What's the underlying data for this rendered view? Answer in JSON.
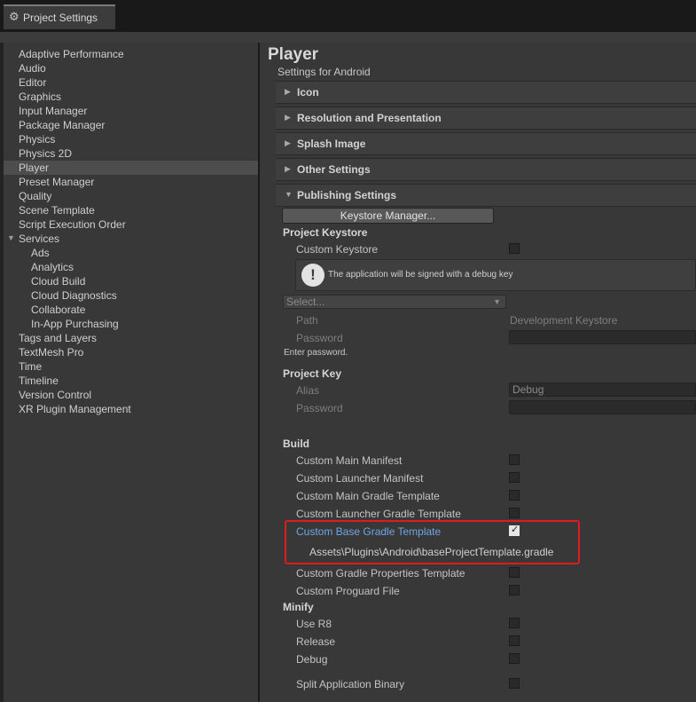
{
  "window": {
    "tab_title": "Project Settings",
    "tab_icon": "gear-icon"
  },
  "sidebar": {
    "items": [
      {
        "label": "Adaptive Performance",
        "indent": 0
      },
      {
        "label": "Audio",
        "indent": 0
      },
      {
        "label": "Editor",
        "indent": 0
      },
      {
        "label": "Graphics",
        "indent": 0
      },
      {
        "label": "Input Manager",
        "indent": 0
      },
      {
        "label": "Package Manager",
        "indent": 0
      },
      {
        "label": "Physics",
        "indent": 0
      },
      {
        "label": "Physics 2D",
        "indent": 0
      },
      {
        "label": "Player",
        "indent": 0,
        "selected": true
      },
      {
        "label": "Preset Manager",
        "indent": 0
      },
      {
        "label": "Quality",
        "indent": 0
      },
      {
        "label": "Scene Template",
        "indent": 0
      },
      {
        "label": "Script Execution Order",
        "indent": 0
      },
      {
        "label": "Services",
        "indent": 0,
        "expanded": true
      },
      {
        "label": "Ads",
        "indent": 1
      },
      {
        "label": "Analytics",
        "indent": 1
      },
      {
        "label": "Cloud Build",
        "indent": 1
      },
      {
        "label": "Cloud Diagnostics",
        "indent": 1
      },
      {
        "label": "Collaborate",
        "indent": 1
      },
      {
        "label": "In-App Purchasing",
        "indent": 1
      },
      {
        "label": "Tags and Layers",
        "indent": 0
      },
      {
        "label": "TextMesh Pro",
        "indent": 0
      },
      {
        "label": "Time",
        "indent": 0
      },
      {
        "label": "Timeline",
        "indent": 0
      },
      {
        "label": "Version Control",
        "indent": 0
      },
      {
        "label": "XR Plugin Management",
        "indent": 0
      }
    ]
  },
  "main": {
    "title": "Player",
    "subtitle": "Settings for Android",
    "sections": {
      "icon": "Icon",
      "resolution": "Resolution and Presentation",
      "splash": "Splash Image",
      "other": "Other Settings",
      "publishing": "Publishing Settings"
    },
    "keystore_manager_button": "Keystore Manager...",
    "project_keystore": {
      "header": "Project Keystore",
      "custom_keystore_label": "Custom Keystore",
      "custom_keystore_checked": false,
      "help_text": "The application will be signed with a debug key",
      "select_placeholder": "Select...",
      "path_label": "Path",
      "path_value": "Development Keystore",
      "password_label": "Password",
      "password_value": "",
      "password_hint": "Enter password."
    },
    "project_key": {
      "header": "Project Key",
      "alias_label": "Alias",
      "alias_value": "Debug",
      "password_label": "Password",
      "password_value": ""
    },
    "build": {
      "header": "Build",
      "custom_main_manifest": "Custom Main Manifest",
      "custom_launcher_manifest": "Custom Launcher Manifest",
      "custom_main_gradle_template": "Custom Main Gradle Template",
      "custom_launcher_gradle_template": "Custom Launcher Gradle Template",
      "custom_base_gradle_template": "Custom Base Gradle Template",
      "custom_base_gradle_template_checked": true,
      "custom_base_gradle_path": "Assets\\Plugins\\Android\\baseProjectTemplate.gradle",
      "custom_gradle_properties_template": "Custom Gradle Properties Template",
      "custom_proguard_file": "Custom Proguard File"
    },
    "minify": {
      "header": "Minify",
      "use_r8": "Use R8",
      "release": "Release",
      "debug": "Debug"
    },
    "split_application_binary": "Split Application Binary"
  },
  "colors": {
    "highlight_label": "#6ea6e8",
    "annotation_box": "#e01b1b"
  }
}
